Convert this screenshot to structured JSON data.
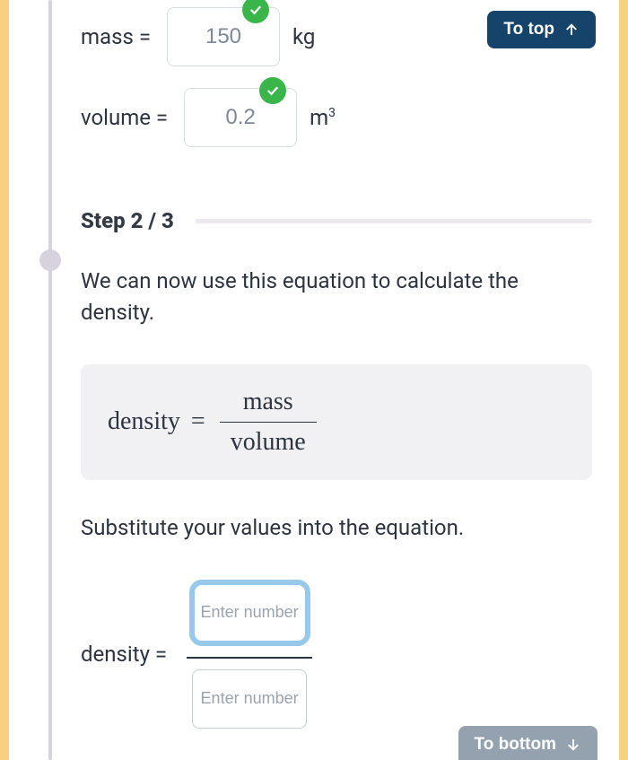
{
  "nav": {
    "to_top_label": "To top",
    "to_bottom_label": "To bottom"
  },
  "fields": {
    "mass": {
      "label": "mass =",
      "value": "150",
      "unit": "kg"
    },
    "volume": {
      "label": "volume =",
      "value": "0.2",
      "unit_base": "m",
      "unit_sup": "3"
    }
  },
  "step": {
    "title": "Step 2 / 3"
  },
  "text": {
    "intro": "We can now use this equation to calculate the density.",
    "substitute": "Substitute your values into the equation."
  },
  "equation": {
    "lhs": "density",
    "equals": "=",
    "numerator": "mass",
    "denominator": "volume"
  },
  "substitution": {
    "lhs": "density =",
    "placeholder_num": "Enter number",
    "placeholder_den": "Enter number",
    "value_num": "",
    "value_den": ""
  }
}
